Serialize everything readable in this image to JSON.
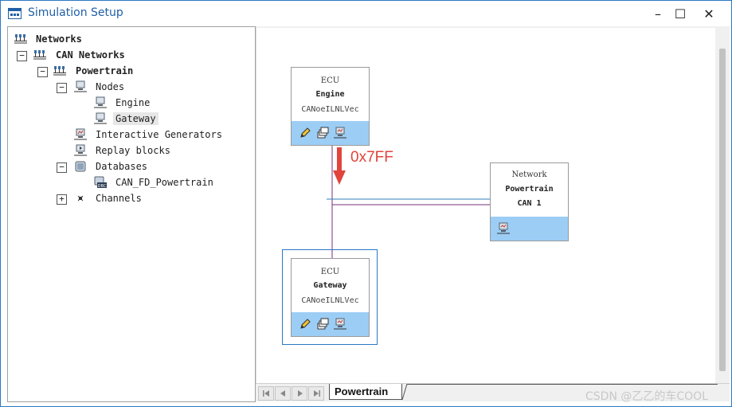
{
  "window": {
    "title": "Simulation Setup",
    "controls": {
      "minimize": "–",
      "maximize": "☐",
      "close": "✕"
    }
  },
  "tree": {
    "root": "Networks",
    "can_networks": "CAN Networks",
    "powertrain": "Powertrain",
    "nodes": "Nodes",
    "engine": "Engine",
    "gateway": "Gateway",
    "interactive_generators": "Interactive Generators",
    "replay_blocks": "Replay blocks",
    "databases": "Databases",
    "database_file": "CAN_FD_Powertrain",
    "channels": "Channels",
    "collapse_symbol": "−",
    "expand_symbol": "+"
  },
  "diagram": {
    "engine_block": {
      "type": "ECU",
      "name": "Engine",
      "model": "CANoeILNLVec"
    },
    "gateway_block": {
      "type": "ECU",
      "name": "Gateway",
      "model": "CANoeILNLVec"
    },
    "network_block": {
      "type": "Network",
      "name": "Powertrain",
      "bus": "CAN 1"
    },
    "message_id": "0x7FF",
    "colors": {
      "block_bar": "#9ccdf5",
      "bus_line_blue": "#2f7fbf",
      "bus_line_purple": "#7a2e7e",
      "arrow_red": "#e0443c"
    }
  },
  "tabs": {
    "active": "Powertrain",
    "nav": [
      "first",
      "previous",
      "next",
      "last"
    ]
  },
  "watermark": "CSDN @乙乙的车COOL"
}
